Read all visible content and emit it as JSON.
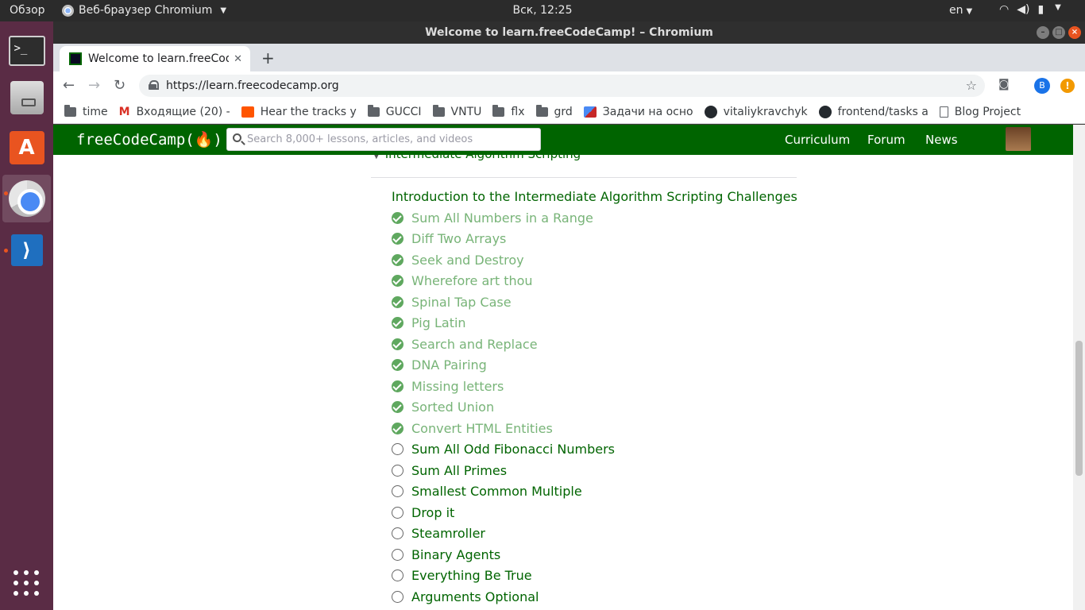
{
  "system": {
    "activities": "Обзор",
    "app_name": "Веб-браузер Chromium",
    "clock": "Вск, 12:25",
    "lang": "en"
  },
  "dock": {
    "apps": [
      "terminal-icon",
      "files-icon",
      "software-center-icon",
      "chromium-icon",
      "vscode-icon"
    ],
    "show_apps_icon": "app-grid-icon"
  },
  "window": {
    "title": "Welcome to learn.freeCodeCamp! – Chromium"
  },
  "browser": {
    "tab_title": "Welcome to learn.freeCodeCamp!",
    "url": "https://learn.freecodecamp.org",
    "profile_initial": "B",
    "alert_glyph": "!",
    "bookmarks": [
      {
        "label": "time",
        "icon": "folder-icon"
      },
      {
        "label": "Входящие (20) -",
        "icon": "gmail-icon"
      },
      {
        "label": "Hear the tracks y",
        "icon": "soundcloud-icon"
      },
      {
        "label": "GUCCI",
        "icon": "folder-icon"
      },
      {
        "label": "VNTU",
        "icon": "folder-icon"
      },
      {
        "label": "flx",
        "icon": "folder-icon"
      },
      {
        "label": "grd",
        "icon": "folder-icon"
      },
      {
        "label": "Задачи на осно",
        "icon": "tasks-icon"
      },
      {
        "label": "vitaliykravchyk",
        "icon": "github-icon"
      },
      {
        "label": "frontend/tasks a",
        "icon": "github-icon"
      },
      {
        "label": "Blog Project",
        "icon": "document-icon"
      }
    ]
  },
  "fcc": {
    "logo": "freeCodeCamp(🔥)",
    "search_placeholder": "Search 8,000+ lessons, articles, and videos",
    "nav": {
      "curriculum": "Curriculum",
      "forum": "Forum",
      "news": "News"
    },
    "brand_color": "#006400"
  },
  "curriculum": {
    "section_title": "Intermediate Algorithm Scripting",
    "intro": "Introduction to the Intermediate Algorithm Scripting Challenges",
    "challenges": [
      {
        "name": "Sum All Numbers in a Range",
        "completed": true
      },
      {
        "name": "Diff Two Arrays",
        "completed": true
      },
      {
        "name": "Seek and Destroy",
        "completed": true
      },
      {
        "name": "Wherefore art thou",
        "completed": true
      },
      {
        "name": "Spinal Tap Case",
        "completed": true
      },
      {
        "name": "Pig Latin",
        "completed": true
      },
      {
        "name": "Search and Replace",
        "completed": true
      },
      {
        "name": "DNA Pairing",
        "completed": true
      },
      {
        "name": "Missing letters",
        "completed": true
      },
      {
        "name": "Sorted Union",
        "completed": true
      },
      {
        "name": "Convert HTML Entities",
        "completed": true
      },
      {
        "name": "Sum All Odd Fibonacci Numbers",
        "completed": false
      },
      {
        "name": "Sum All Primes",
        "completed": false
      },
      {
        "name": "Smallest Common Multiple",
        "completed": false
      },
      {
        "name": "Drop it",
        "completed": false
      },
      {
        "name": "Steamroller",
        "completed": false
      },
      {
        "name": "Binary Agents",
        "completed": false
      },
      {
        "name": "Everything Be True",
        "completed": false
      },
      {
        "name": "Arguments Optional",
        "completed": false
      }
    ]
  }
}
